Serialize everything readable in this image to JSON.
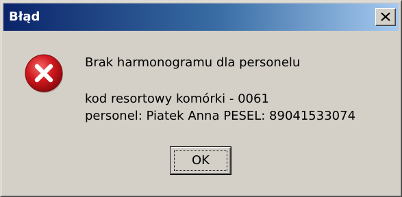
{
  "window": {
    "title": "Błąd"
  },
  "icons": {
    "close": "close-icon",
    "error": "error-icon"
  },
  "message": {
    "line1": "Brak harmonogramu dla personelu",
    "line2": "kod resortowy komórki - 0061",
    "line3": "personel: Piatek Anna PESEL: 89041533074"
  },
  "buttons": {
    "ok_label": "OK"
  },
  "colors": {
    "titlebar_start": "#0a246a",
    "titlebar_end": "#a6caf0",
    "dialog_background": "#d4d0c8",
    "error_red": "#c8141c"
  }
}
